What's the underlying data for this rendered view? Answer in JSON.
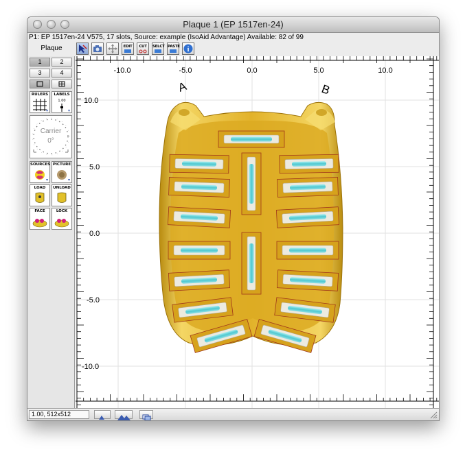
{
  "window": {
    "title": "Plaque 1 (EP 1517en-24)",
    "info": "P1: EP 1517en-24 V575, 17 slots, Source: example (IsoAid Advantage) Available: 82 of 99"
  },
  "toolbar": {
    "plaque_label": "Plaque",
    "buttons": [
      {
        "name": "select-tool-button",
        "label": ""
      },
      {
        "name": "view-tool-button",
        "label": ""
      },
      {
        "name": "move-tool-button",
        "label": ""
      },
      {
        "name": "edit-button",
        "label": "EDIT"
      },
      {
        "name": "cut-button",
        "label": "CUT"
      },
      {
        "name": "select-button",
        "label": "SELCT"
      },
      {
        "name": "paste-button",
        "label": "PASTE"
      },
      {
        "name": "info-button",
        "label": "i"
      }
    ]
  },
  "sidebar": {
    "view_tabs": [
      "1",
      "2",
      "3",
      "4"
    ],
    "rulers_label": "RULERS",
    "labels_label": "LABELS",
    "labels_value": "1.00",
    "carrier_label": "Carrier",
    "carrier_angle": "0°",
    "sources_label": "SOURCES",
    "picture_label": "PICTURE",
    "load_label": "LOAD",
    "unload_label": "UNLOAD",
    "face_label": "FACE",
    "lock_label": "LOCK"
  },
  "canvas": {
    "x_ticks": [
      "-10.0",
      "-5.0",
      "0.0",
      "5.0",
      "10.0"
    ],
    "y_ticks": [
      "10.0",
      "5.0",
      "0.0",
      "-5.0",
      "-10.0"
    ],
    "label_a": "A",
    "label_b": "B",
    "colors": {
      "plaque": "#e2b22a",
      "plaque_light": "#f4d664",
      "plaque_dark": "#b98c10",
      "seed": "#62d2d8",
      "slot_outline": "#a0361a"
    }
  },
  "statusbar": {
    "zoom": "1.00, 512x512"
  }
}
